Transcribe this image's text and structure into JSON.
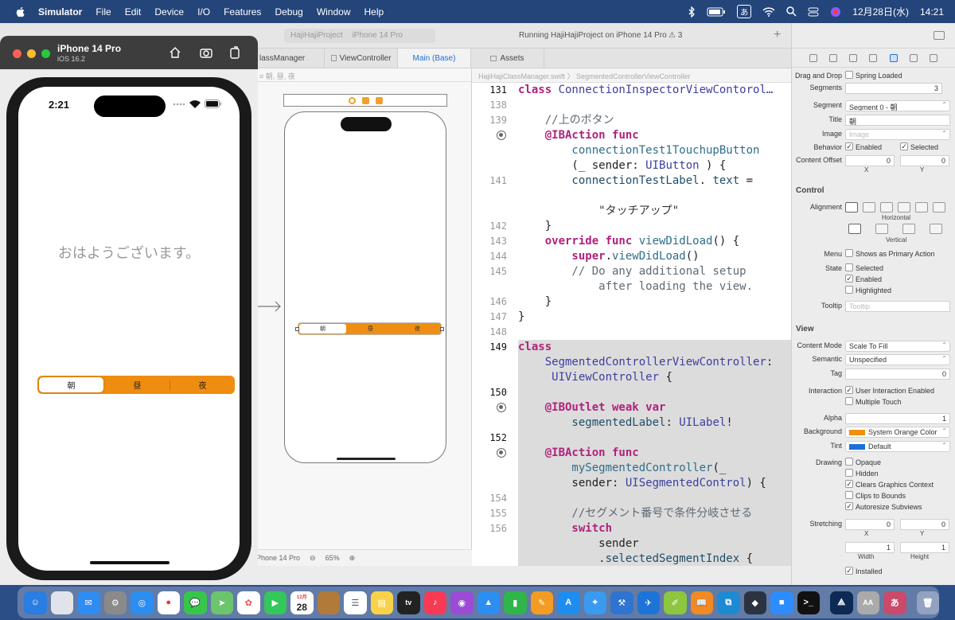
{
  "menubar": {
    "app": "Simulator",
    "items": [
      "File",
      "Edit",
      "Device",
      "I/O",
      "Features",
      "Debug",
      "Window",
      "Help"
    ],
    "ime": "あ",
    "date": "12月28日(水)",
    "time": "14:21"
  },
  "xcode": {
    "scheme_project": "HajiHajiProject",
    "scheme_device": "iPhone 14 Pro",
    "status": "Running HajiHajiProject on iPhone 14 Pro",
    "warnings": "3",
    "tabs": [
      "lassManager",
      "ViewController",
      "Main (Base)",
      "Assets"
    ],
    "canvas_jump": "≡ 朝, 昼, 夜",
    "canvas_device": "iPhone 14 Pro",
    "zoom": "65%",
    "bottom_project": "HajiHajiProject",
    "editor_crumb": "HajiHajiClassManager.swift 〉 SegmentedControllerViewController",
    "scene_segments": [
      "朝",
      "昼",
      "夜"
    ]
  },
  "code": [
    {
      "n": "131",
      "t": [
        [
          "kw",
          "class "
        ],
        [
          "ty",
          "ConnectionInspectorViewContorol…"
        ]
      ],
      "hl": true
    },
    {
      "n": "138",
      "t": []
    },
    {
      "n": "139",
      "t": [
        [
          "cm",
          "    //上のボタン"
        ]
      ]
    },
    {
      "n": "",
      "bp": true,
      "t": [
        [
          "kw",
          "    @IBAction "
        ],
        [
          "kw",
          "func"
        ]
      ]
    },
    {
      "n": "",
      "t": [
        [
          "fn",
          "        connectionTest1TouchupButton"
        ]
      ]
    },
    {
      "n": "",
      "t": [
        [
          "",
          "        (_ sender: "
        ],
        [
          "ty",
          "UIButton"
        ],
        [
          "",
          " ) {"
        ]
      ]
    },
    {
      "n": "141",
      "t": [
        [
          "nm",
          "        connectionTestLabel"
        ],
        [
          "",
          ". "
        ],
        [
          "nm",
          "text"
        ],
        [
          "",
          " ="
        ]
      ]
    },
    {
      "n": "",
      "t": []
    },
    {
      "n": "",
      "t": [
        [
          "str",
          "            \"タッチアップ\""
        ]
      ]
    },
    {
      "n": "142",
      "t": [
        [
          "",
          "    }"
        ]
      ]
    },
    {
      "n": "143",
      "t": [
        [
          "kw",
          "    override func "
        ],
        [
          "fn",
          "viewDidLoad"
        ],
        [
          "",
          "() {"
        ]
      ]
    },
    {
      "n": "144",
      "t": [
        [
          "kw",
          "        super"
        ],
        [
          "",
          "."
        ],
        [
          "fn",
          "viewDidLoad"
        ],
        [
          "",
          "()"
        ]
      ]
    },
    {
      "n": "145",
      "t": [
        [
          "cm",
          "        // Do any additional setup"
        ]
      ]
    },
    {
      "n": "",
      "t": [
        [
          "cm",
          "            after loading the view."
        ]
      ]
    },
    {
      "n": "146",
      "t": [
        [
          "",
          "    }"
        ]
      ]
    },
    {
      "n": "147",
      "t": [
        [
          "",
          "}"
        ]
      ]
    },
    {
      "n": "148",
      "t": []
    },
    {
      "n": "149",
      "t": [
        [
          "kw",
          "class"
        ]
      ],
      "hl": true,
      "bg": true
    },
    {
      "n": "",
      "t": [
        [
          "ty",
          "    SegmentedControllerViewController"
        ],
        [
          "",
          ":"
        ]
      ],
      "bg": true
    },
    {
      "n": "",
      "t": [
        [
          "ty",
          "     UIViewController"
        ],
        [
          "",
          " {"
        ]
      ],
      "bg": true
    },
    {
      "n": "150",
      "t": [],
      "hl": true,
      "bg": true
    },
    {
      "n": "",
      "bp": true,
      "t": [
        [
          "kw",
          "    @IBOutlet weak var"
        ]
      ],
      "bg": true
    },
    {
      "n": "",
      "t": [
        [
          "nm",
          "        segmentedLabel"
        ],
        [
          "",
          ": "
        ],
        [
          "ty",
          "UILabel"
        ],
        [
          "",
          "!"
        ]
      ],
      "bg": true
    },
    {
      "n": "152",
      "t": [],
      "hl": true,
      "bg": true
    },
    {
      "n": "",
      "bp": true,
      "t": [
        [
          "kw",
          "    @IBAction func"
        ]
      ],
      "bg": true
    },
    {
      "n": "",
      "t": [
        [
          "fn",
          "        mySegmentedController"
        ],
        [
          "",
          "(_"
        ]
      ],
      "bg": true
    },
    {
      "n": "",
      "t": [
        [
          "",
          "        sender: "
        ],
        [
          "ty",
          "UISegmentedControl"
        ],
        [
          "",
          ") {"
        ]
      ],
      "bg": true
    },
    {
      "n": "154",
      "t": [],
      "bg": true
    },
    {
      "n": "155",
      "t": [
        [
          "cm",
          "        //セグメント番号で条件分岐させる"
        ]
      ],
      "bg": true
    },
    {
      "n": "156",
      "t": [
        [
          "kw",
          "        switch"
        ]
      ],
      "bg": true
    },
    {
      "n": "",
      "t": [
        [
          "",
          "            sender"
        ]
      ],
      "bg": true
    },
    {
      "n": "",
      "t": [
        [
          "",
          "            ."
        ],
        [
          "nm",
          "selectedSegmentIndex"
        ],
        [
          "",
          " {"
        ]
      ],
      "bg": true
    }
  ],
  "inspector": {
    "drag_drop_label": "Drag and Drop",
    "spring_loaded": "Spring Loaded",
    "segments_label": "Segments",
    "segments_value": "3",
    "segment_label": "Segment",
    "segment_value": "Segment 0 - 朝",
    "title_label": "Title",
    "title_value": "朝",
    "image_label": "Image",
    "image_placeholder": "Image",
    "behavior_label": "Behavior",
    "enabled": "Enabled",
    "selected": "Selected",
    "content_offset_label": "Content Offset",
    "offset_x": "0",
    "offset_y": "0",
    "x": "X",
    "y": "Y",
    "control_header": "Control",
    "alignment_label": "Alignment",
    "horizontal": "Horizontal",
    "vertical": "Vertical",
    "menu_label": "Menu",
    "show_primary": "Shows as Primary Action",
    "state_label": "State",
    "state_selected": "Selected",
    "state_enabled": "Enabled",
    "state_highlighted": "Highlighted",
    "tooltip_label": "Tooltip",
    "tooltip_placeholder": "Tooltip",
    "view_header": "View",
    "content_mode_label": "Content Mode",
    "content_mode": "Scale To Fill",
    "semantic_label": "Semantic",
    "semantic": "Unspecified",
    "tag_label": "Tag",
    "tag": "0",
    "interaction_label": "Interaction",
    "user_interaction": "User Interaction Enabled",
    "multiple_touch": "Multiple Touch",
    "alpha_label": "Alpha",
    "alpha": "1",
    "background_label": "Background",
    "background": "System Orange Color",
    "tint_label": "Tint",
    "tint": "Default",
    "drawing_label": "Drawing",
    "opaque": "Opaque",
    "hidden": "Hidden",
    "clears_graphics": "Clears Graphics Context",
    "clips": "Clips to Bounds",
    "autoresize": "Autoresize Subviews",
    "stretching_label": "Stretching",
    "sx": "0",
    "sy": "0",
    "sw": "1",
    "sh": "1",
    "width": "Width",
    "height": "Height",
    "installed": "Installed",
    "colors": {
      "background": "#f0900f",
      "tint": "#1c6fd8"
    }
  },
  "simulator": {
    "device": "iPhone 14 Pro",
    "os": "iOS 16.2",
    "time": "2:21",
    "label": "おはようございます。",
    "segments": [
      "朝",
      "昼",
      "夜"
    ],
    "selected": 0
  },
  "dock": {
    "calendar_month": "12月",
    "calendar_day": "28",
    "tv": "tv",
    "ime": "あ",
    "extra": "AA"
  }
}
